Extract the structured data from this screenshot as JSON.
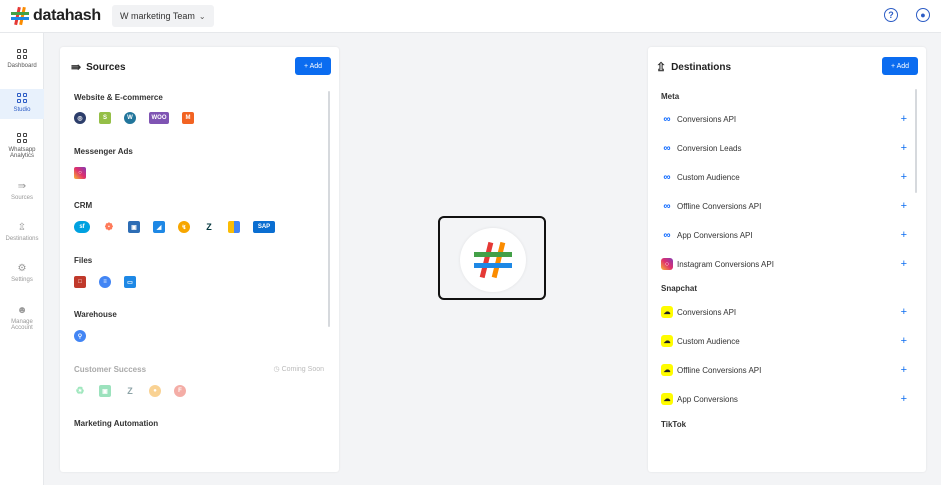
{
  "brand": {
    "name": "datahash"
  },
  "header": {
    "team": "W marketing Team",
    "help_icon": "help-circle-icon",
    "account_icon": "user-circle-icon"
  },
  "sidebar": {
    "items": [
      {
        "label": "Dashboard",
        "icon": "dashboard-icon",
        "active": false
      },
      {
        "label": "Studio",
        "icon": "studio-icon",
        "active": true
      },
      {
        "label": "Whatsapp Analytics",
        "icon": "whatsapp-analytics-icon",
        "active": false
      },
      {
        "label": "Sources",
        "icon": "sources-icon",
        "active": false
      },
      {
        "label": "Destinations",
        "icon": "destinations-icon",
        "active": false
      },
      {
        "label": "Settings",
        "icon": "settings-icon",
        "active": false
      },
      {
        "label": "Manage Account",
        "icon": "manage-account-icon",
        "active": false
      }
    ]
  },
  "sources": {
    "title": "Sources",
    "add_label": "+ Add",
    "categories": [
      {
        "title": "Website & E-commerce",
        "icons": [
          "globe-icon",
          "shopify-icon",
          "wordpress-icon",
          "woocommerce-icon",
          "magento-icon"
        ]
      },
      {
        "title": "Messenger Ads",
        "icons": [
          "instagram-icon"
        ]
      },
      {
        "title": "CRM",
        "icons": [
          "salesforce-icon",
          "hubspot-icon",
          "crm-box-icon",
          "flag-crm-icon",
          "bolt-crm-icon",
          "zendesk-icon",
          "grid-crm-icon",
          "sap-icon"
        ]
      },
      {
        "title": "Files",
        "icons": [
          "file-red-icon",
          "gcs-icon",
          "folder-blue-icon"
        ]
      },
      {
        "title": "Warehouse",
        "icons": [
          "bigquery-icon"
        ]
      },
      {
        "title": "Customer Success",
        "coming_soon": "Coming Soon",
        "icons": [
          "cs-green-icon",
          "freshdesk-icon",
          "zendesk-cs-icon",
          "chat-orange-icon",
          "cs-red-icon"
        ]
      },
      {
        "title": "Marketing Automation",
        "icons": []
      }
    ],
    "woo_text": "WOO",
    "sap_text": "SAP"
  },
  "destinations": {
    "title": "Destinations",
    "add_label": "+ Add",
    "groups": [
      {
        "title": "Meta",
        "items": [
          {
            "label": "Conversions API",
            "icon": "meta-icon"
          },
          {
            "label": "Conversion Leads",
            "icon": "meta-icon"
          },
          {
            "label": "Custom Audience",
            "icon": "meta-icon"
          },
          {
            "label": "Offline Conversions API",
            "icon": "meta-icon"
          },
          {
            "label": "App Conversions API",
            "icon": "meta-icon"
          },
          {
            "label": "Instagram Conversions API",
            "icon": "instagram-icon"
          }
        ]
      },
      {
        "title": "Snapchat",
        "items": [
          {
            "label": "Conversions API",
            "icon": "snapchat-icon"
          },
          {
            "label": "Custom Audience",
            "icon": "snapchat-icon"
          },
          {
            "label": "Offline Conversions API",
            "icon": "snapchat-icon"
          },
          {
            "label": "App Conversions",
            "icon": "snapchat-icon"
          }
        ]
      },
      {
        "title": "TikTok",
        "items": []
      }
    ]
  },
  "colors": {
    "accent": "#0b6cf0",
    "active_bg": "#e8f1fc",
    "active_text": "#2c5cc5"
  }
}
